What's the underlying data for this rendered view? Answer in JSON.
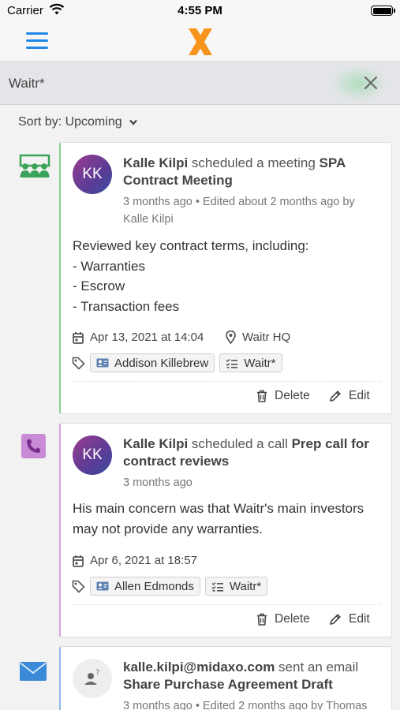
{
  "status_bar": {
    "carrier": "Carrier",
    "time": "4:55 PM"
  },
  "search": {
    "query": "Waitr*"
  },
  "sort": {
    "label": "Sort by: Upcoming"
  },
  "activities": [
    {
      "type": "meeting",
      "avatar_initials": "KK",
      "author": "Kalle Kilpi",
      "verb": " scheduled a meeting ",
      "subject_line1": "SPA",
      "subject_line2": "Contract Meeting",
      "meta_line1": "3 months ago • Edited about 2 months ago by",
      "meta_line2": "Kalle Kilpi",
      "body": [
        "Reviewed key contract terms, including:",
        "- Warranties",
        "- Escrow",
        "- Transaction fees"
      ],
      "date": "Apr 13, 2021 at 14:04",
      "location": "Waitr HQ",
      "tags": [
        "Addison Killebrew",
        "Waitr*"
      ],
      "delete_label": "Delete",
      "edit_label": "Edit"
    },
    {
      "type": "call",
      "avatar_initials": "KK",
      "author": "Kalle Kilpi",
      "verb": " scheduled a call ",
      "subject_line1": "Prep call for",
      "subject_line2": "contract reviews",
      "meta_line1": "3 months ago",
      "body": [
        "His main concern was that Waitr's main investors",
        "may not provide any warranties."
      ],
      "date": "Apr 6, 2021 at 18:57",
      "tags": [
        "Allen Edmonds",
        "Waitr*"
      ],
      "delete_label": "Delete",
      "edit_label": "Edit"
    },
    {
      "type": "email",
      "author": "kalle.kilpi@midaxo.com",
      "verb": " sent an email",
      "subject": "Share Purchase Agreement Draft",
      "meta_line1": "3 months ago • Edited 2 months ago by Thomas"
    }
  ],
  "colors": {
    "accent": "#1e88e5",
    "logo": "#f7941d",
    "meeting": "#3aa35a",
    "call": "#a454c4",
    "email": "#3a8ad8"
  }
}
